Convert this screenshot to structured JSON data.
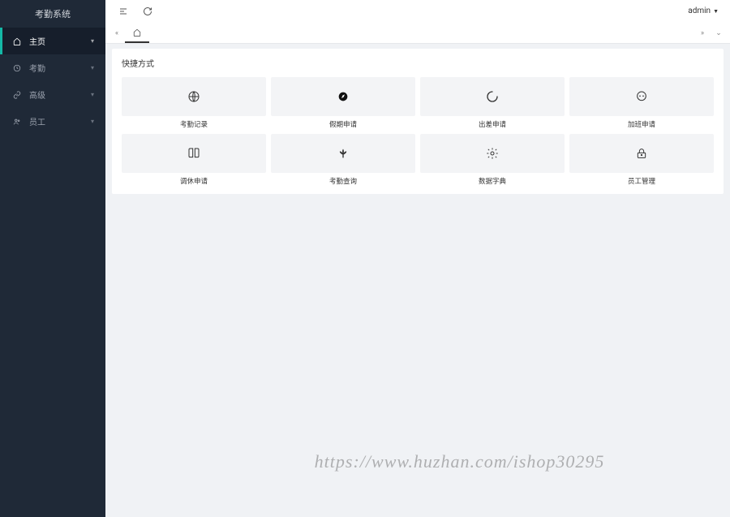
{
  "app": {
    "title": "考勤系统"
  },
  "sidebar": {
    "items": [
      {
        "label": "主页",
        "active": true,
        "icon": "home"
      },
      {
        "label": "考勤",
        "active": false,
        "icon": "clock"
      },
      {
        "label": "高级",
        "active": false,
        "icon": "link"
      },
      {
        "label": "员工",
        "active": false,
        "icon": "users"
      }
    ]
  },
  "header": {
    "user": "admin"
  },
  "tabs": {
    "home_icon": "home"
  },
  "quick": {
    "title": "快捷方式",
    "items": [
      {
        "label": "考勤记录",
        "icon": "globe"
      },
      {
        "label": "假期申请",
        "icon": "compass"
      },
      {
        "label": "出差申请",
        "icon": "loading"
      },
      {
        "label": "加班申请",
        "icon": "chat"
      },
      {
        "label": "调休申请",
        "icon": "book"
      },
      {
        "label": "考勤查询",
        "icon": "palm"
      },
      {
        "label": "数据字典",
        "icon": "gear"
      },
      {
        "label": "员工管理",
        "icon": "lock"
      }
    ]
  },
  "watermark": "https://www.huzhan.com/ishop30295"
}
